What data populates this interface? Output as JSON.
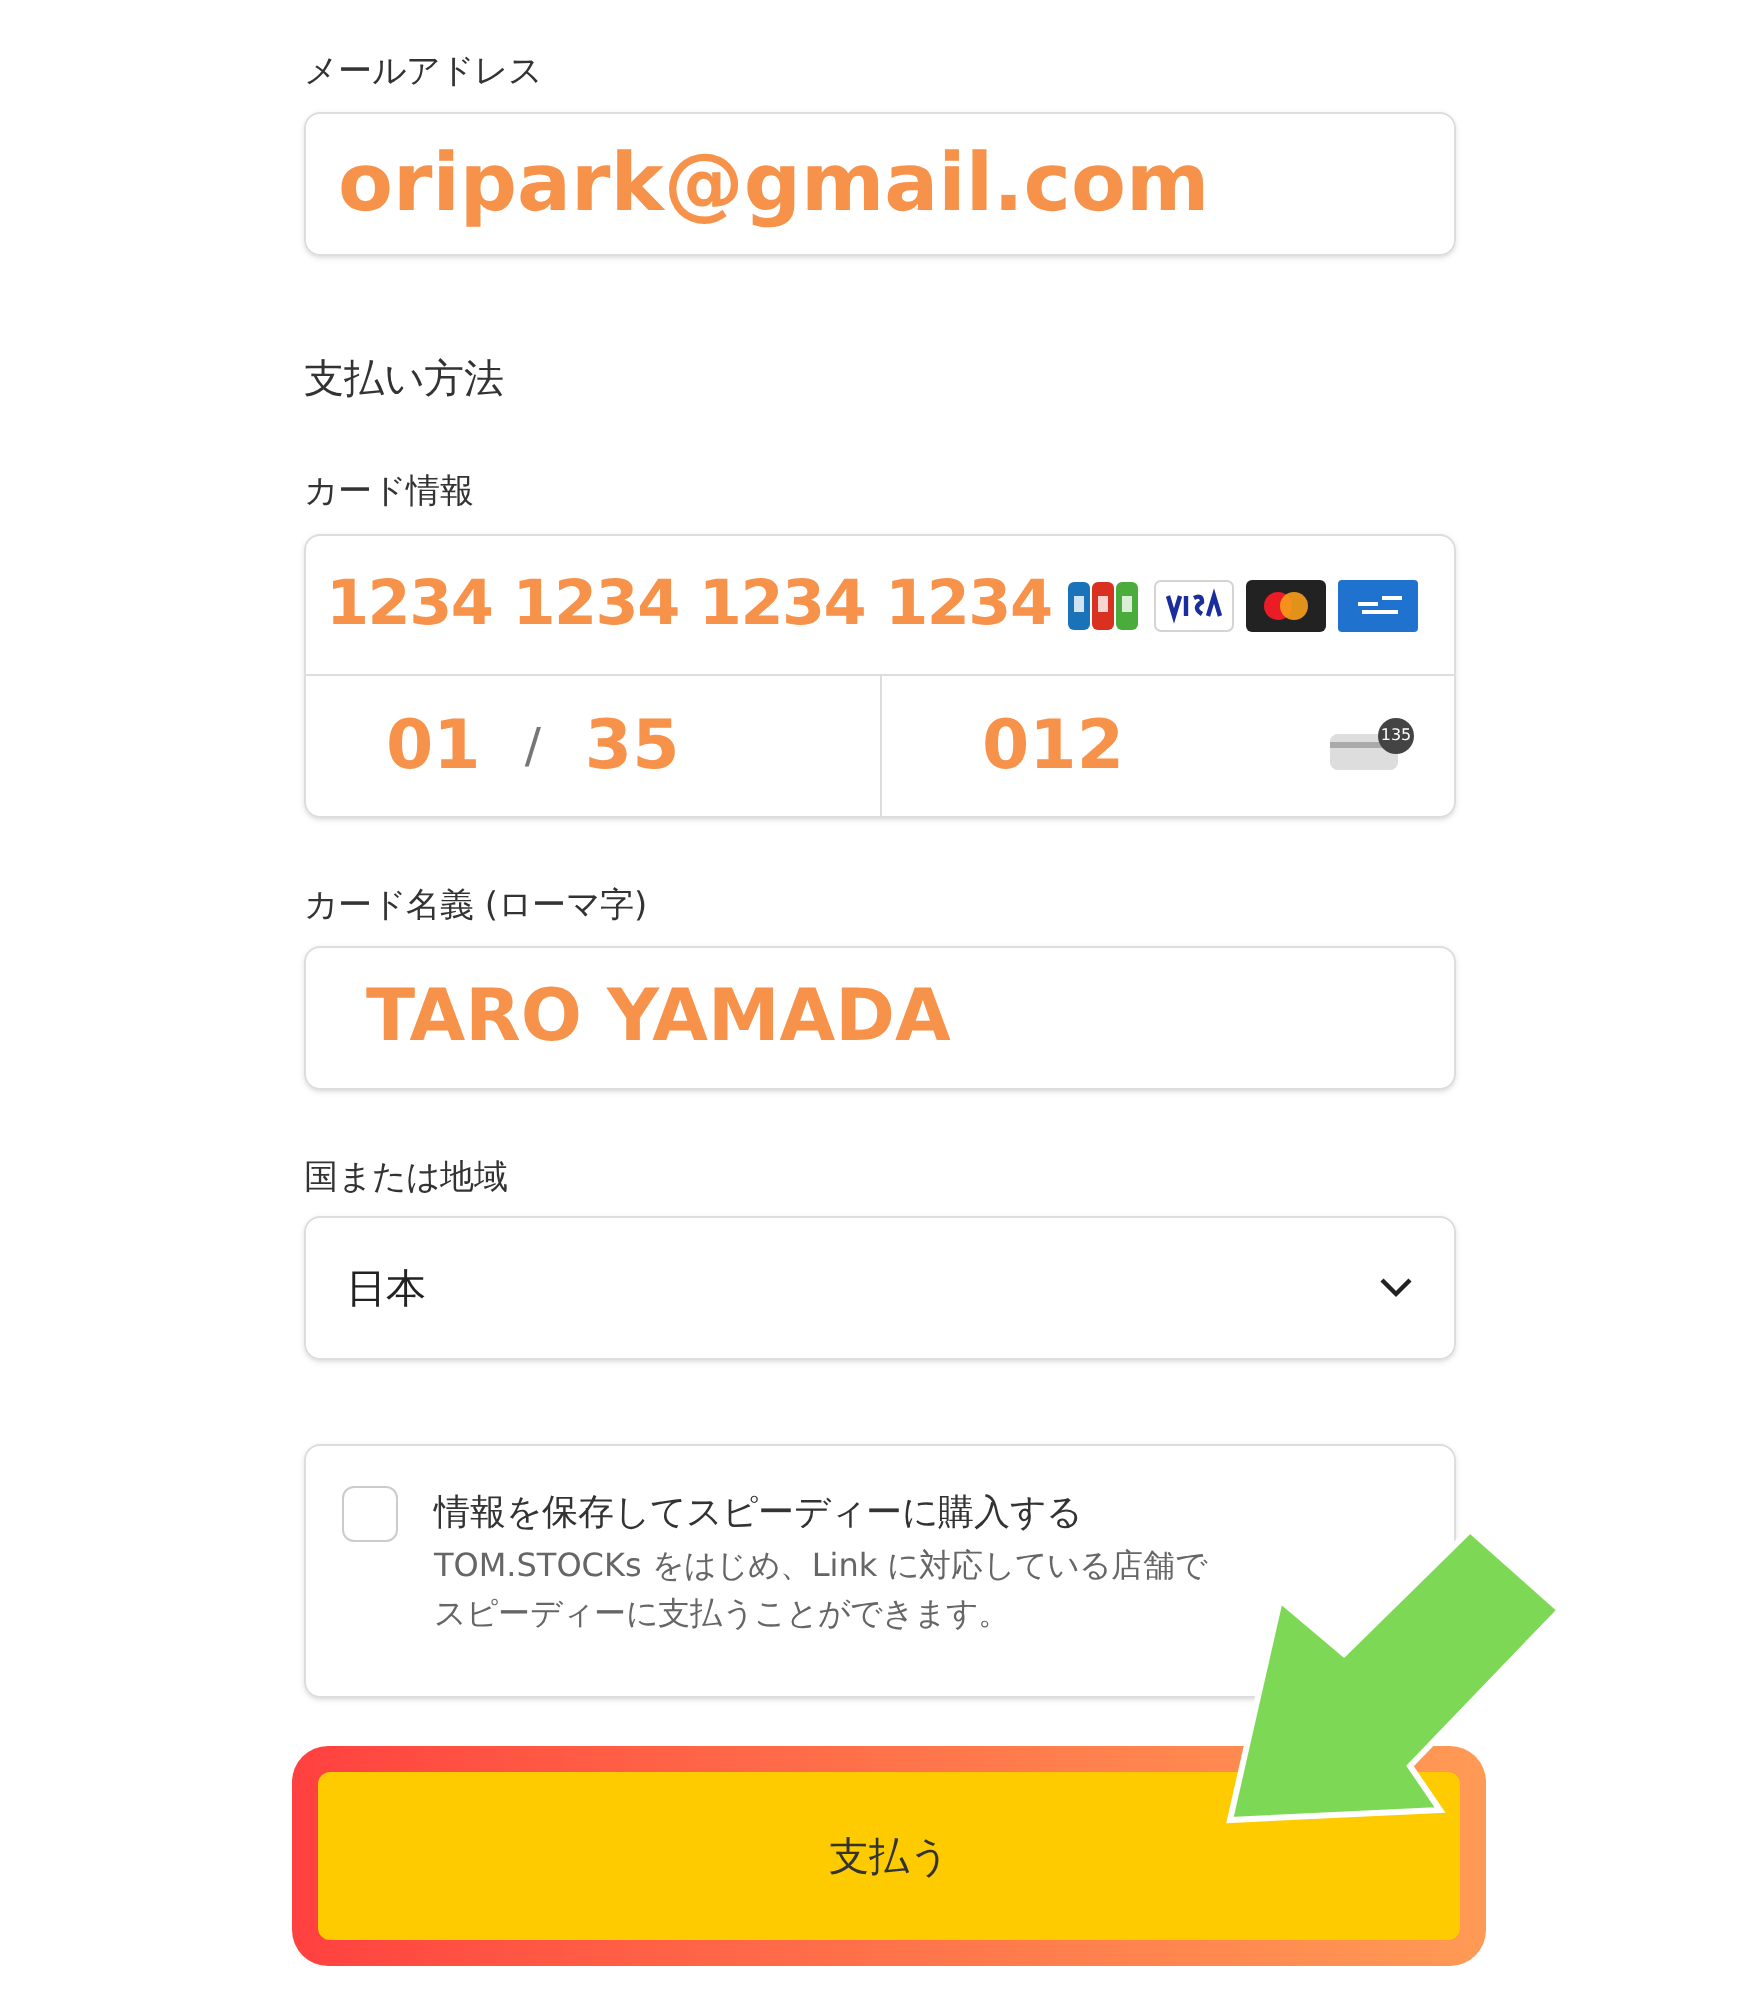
{
  "email": {
    "label": "メールアドレス",
    "value": "oripark@gmail.com"
  },
  "payment": {
    "heading": "支払い方法",
    "card": {
      "label": "カード情報",
      "number": "1234 1234 1234 1234",
      "expiry_month": "01",
      "expiry_separator": "/",
      "expiry_year": "35",
      "cvc": "012",
      "cvc_icon_number": "135"
    },
    "name": {
      "label": "カード名義 (ローマ字)",
      "value": "TARO YAMADA"
    },
    "country": {
      "label": "国または地域",
      "value": "日本"
    },
    "save": {
      "checked": false,
      "title": "情報を保存してスピーディーに購入する",
      "lines": [
        "TOM.STOCKs をはじめ、Link に対応している店舗で",
        "スピーディーに支払うことができます。"
      ]
    },
    "pay_button": "支払う"
  }
}
